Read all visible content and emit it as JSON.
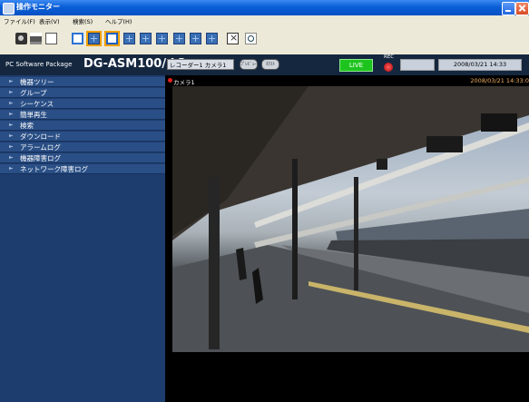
{
  "window": {
    "title": "操作モニター"
  },
  "menu": [
    "ファイル(F)",
    "表示(V)",
    "検索(S)",
    "ヘルプ(H)"
  ],
  "header": {
    "package_label": "PC Software Package",
    "model": "DG-ASM100/ L3",
    "recorder_camera": "レコーダー1 カメラ1",
    "prev_label": "ﾌﾟﾚﾋﾞｭｰ",
    "next_label": "ﾈｸｽﾄ",
    "live": "LIVE",
    "rec": "REC",
    "datetime": "2008/03/21 14:33"
  },
  "sidebar": {
    "items": [
      {
        "label": "機器ツリー"
      },
      {
        "label": "グループ"
      },
      {
        "label": "シーケンス"
      },
      {
        "label": "簡単再生"
      },
      {
        "label": "検索"
      },
      {
        "label": "ダウンロード"
      },
      {
        "label": "アラームログ"
      },
      {
        "label": "機器障害ログ"
      },
      {
        "label": "ネットワーク障害ログ"
      }
    ]
  },
  "video": {
    "camera_label": "カメラ1",
    "timestamp": "2008/03/21 14:33:0"
  },
  "colors": {
    "titlebar": "#0a5fd6",
    "sidebar_bg": "#1e3d6f",
    "sidebar_item": "#2a4f86",
    "header_bg": "#14273f",
    "live": "#1ec41e",
    "rec": "#d00000"
  }
}
